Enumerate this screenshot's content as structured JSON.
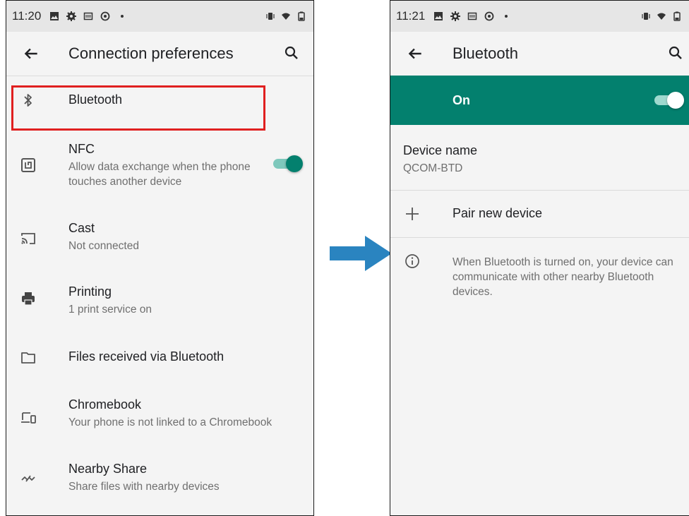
{
  "colors": {
    "accent": "#03806e",
    "accent_track": "#7ec8bc",
    "highlight": "#e02020",
    "arrow": "#2a84c0"
  },
  "left": {
    "status_bar": {
      "time": "11:20"
    },
    "app_bar": {
      "title": "Connection preferences",
      "back_icon": "arrow-left-icon",
      "search_icon": "search-icon"
    },
    "items": [
      {
        "icon": "bluetooth-icon",
        "title": "Bluetooth",
        "subtitle": ""
      },
      {
        "icon": "nfc-icon",
        "title": "NFC",
        "subtitle": "Allow data exchange when the phone touches another device",
        "toggle_on": true
      },
      {
        "icon": "cast-icon",
        "title": "Cast",
        "subtitle": "Not connected"
      },
      {
        "icon": "printer-icon",
        "title": "Printing",
        "subtitle": "1 print service on"
      },
      {
        "icon": "folder-icon",
        "title": "Files received via Bluetooth",
        "subtitle": ""
      },
      {
        "icon": "chromebook-icon",
        "title": "Chromebook",
        "subtitle": "Your phone is not linked to a Chromebook"
      },
      {
        "icon": "nearby-share-icon",
        "title": "Nearby Share",
        "subtitle": "Share files with nearby devices"
      }
    ]
  },
  "right": {
    "status_bar": {
      "time": "11:21"
    },
    "app_bar": {
      "title": "Bluetooth",
      "back_icon": "arrow-left-icon",
      "search_icon": "search-icon"
    },
    "master_switch": {
      "label": "On",
      "toggle_on": true
    },
    "device_name": {
      "title": "Device name",
      "value": "QCOM-BTD"
    },
    "pair": {
      "icon": "plus-icon",
      "label": "Pair new device"
    },
    "info": {
      "icon": "info-icon",
      "text": "When Bluetooth is turned on, your device can communicate with other nearby Bluetooth devices."
    }
  }
}
